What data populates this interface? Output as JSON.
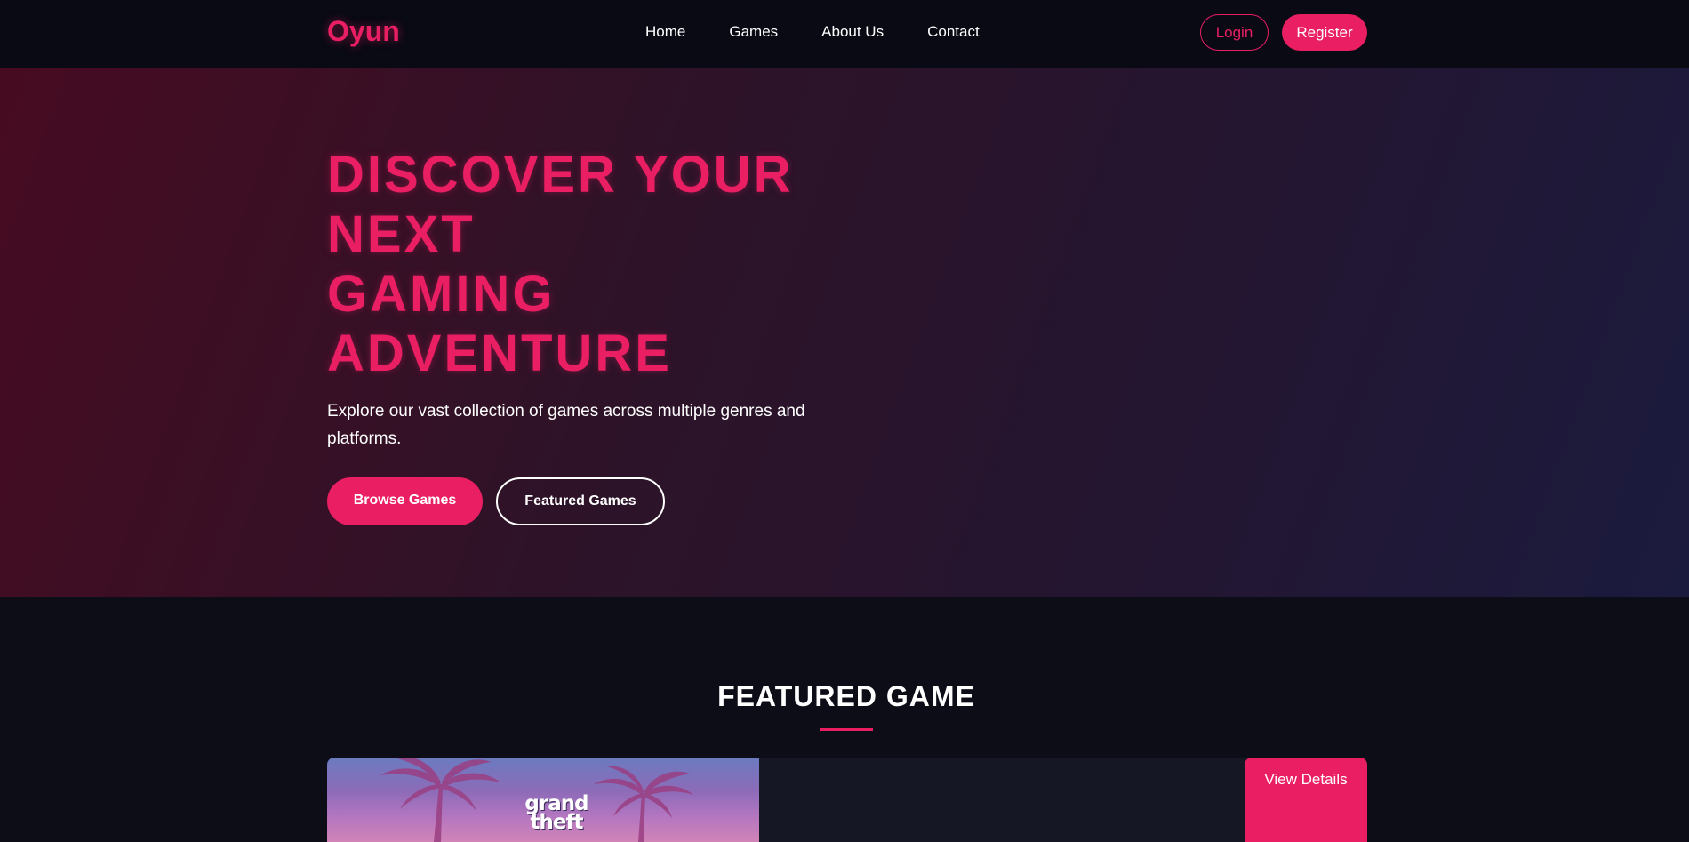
{
  "brand": {
    "logo": "Oyun"
  },
  "nav": {
    "links": [
      {
        "label": "Home"
      },
      {
        "label": "Games"
      },
      {
        "label": "About Us"
      },
      {
        "label": "Contact"
      }
    ],
    "login_label": "Login",
    "register_label": "Register"
  },
  "hero": {
    "title_lines": [
      "DISCOVER YOUR",
      "NEXT",
      "GAMING",
      "ADVENTURE"
    ],
    "subtitle": "Explore our vast collection of games across multiple genres and platforms.",
    "browse_label": "Browse Games",
    "featured_label": "Featured Games"
  },
  "featured": {
    "section_title": "FEATURED GAME",
    "image_logo_lines": [
      "grand",
      "theft"
    ],
    "view_details_label": "View Details"
  },
  "colors": {
    "accent": "#e91e63",
    "background": "#0c0d17",
    "navbar": "#090a14",
    "card": "#161724"
  }
}
